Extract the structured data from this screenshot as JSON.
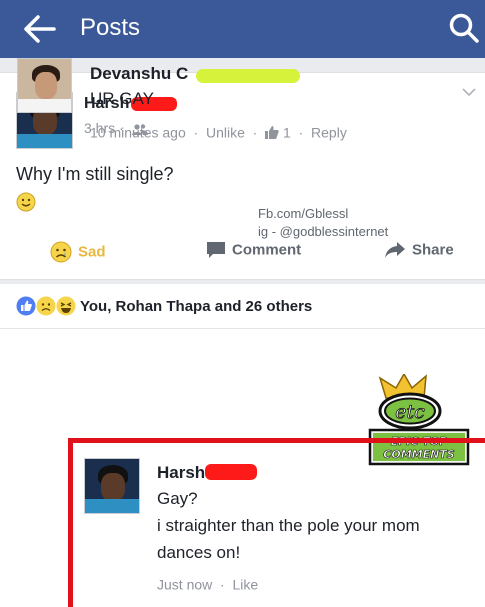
{
  "header": {
    "title": "Posts",
    "back_icon": "back-arrow-icon",
    "search_icon": "search-icon",
    "color": "#3b5998"
  },
  "post": {
    "author": "Harsh",
    "time": "3 hrs",
    "separator": "·",
    "text": "Why I'm still single?",
    "watermark_line1": "Fb.com/Gblessl",
    "watermark_line2": "ig - @godblessinternet",
    "actions": {
      "sad": "Sad",
      "comment": "Comment",
      "share": "Share"
    }
  },
  "reactions": {
    "summary": "You, Rohan Thapa and 26 others"
  },
  "comments": [
    {
      "author": "Devanshu C",
      "text": "UR GAY",
      "time": "10 minutes ago",
      "unlike": "Unlike",
      "like_count": "1",
      "reply": "Reply"
    },
    {
      "author": "Harsh",
      "line1": "Gay?",
      "line2": "i straighter than the pole your mom",
      "line3": "dances on!",
      "time": "Just now",
      "like": "Like"
    }
  ],
  "badge": {
    "line1": "EPIC TOP",
    "line2": "COMMENTS",
    "logo": "etc"
  },
  "colors": {
    "accent": "#3b5998",
    "frame": "#e0111b",
    "redact": "#ff1a1a",
    "highlight": "#d7f23a"
  }
}
